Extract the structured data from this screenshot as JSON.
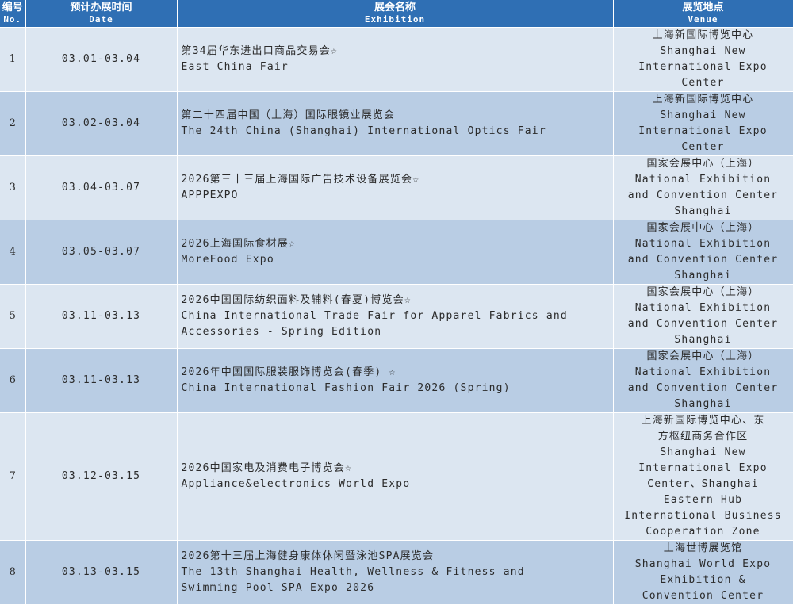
{
  "header": {
    "no_zh": "编号",
    "no_en": "No.",
    "date_zh": "预计办展时间",
    "date_en": "Date",
    "exhibition_zh": "展会名称",
    "exhibition_en": "Exhibition",
    "venue_zh": "展览地点",
    "venue_en": "Venue"
  },
  "rows": [
    {
      "no": "1",
      "date": "03.01-03.04",
      "exhibition": [
        "第34届华东进出口商品交易会☆",
        "East China Fair"
      ],
      "venue": [
        "上海新国际博览中心",
        "Shanghai New",
        "International Expo",
        "Center"
      ]
    },
    {
      "no": "2",
      "date": "03.02-03.04",
      "exhibition": [
        "第二十四届中国（上海）国际眼镜业展览会",
        "The 24th China (Shanghai) International Optics Fair"
      ],
      "venue": [
        "上海新国际博览中心",
        "Shanghai New",
        "International Expo",
        "Center"
      ]
    },
    {
      "no": "3",
      "date": "03.04-03.07",
      "exhibition": [
        "2026第三十三届上海国际广告技术设备展览会☆",
        "APPPEXPO"
      ],
      "venue": [
        "国家会展中心（上海）",
        "National Exhibition",
        "and Convention Center",
        "Shanghai"
      ]
    },
    {
      "no": "4",
      "date": "03.05-03.07",
      "exhibition": [
        "2026上海国际食材展☆",
        "MoreFood Expo"
      ],
      "venue": [
        "国家会展中心（上海）",
        "National Exhibition",
        "and Convention Center",
        "Shanghai"
      ]
    },
    {
      "no": "5",
      "date": "03.11-03.13",
      "exhibition": [
        "2026中国国际纺织面料及辅料(春夏)博览会☆",
        "China International Trade Fair for Apparel Fabrics and",
        "Accessories - Spring Edition"
      ],
      "venue": [
        "国家会展中心（上海）",
        "National Exhibition",
        "and Convention Center",
        "Shanghai"
      ]
    },
    {
      "no": "6",
      "date": "03.11-03.13",
      "exhibition": [
        "2026年中国国际服装服饰博览会(春季) ☆",
        "China International Fashion Fair 2026 (Spring)"
      ],
      "venue": [
        "国家会展中心（上海）",
        "National Exhibition",
        "and Convention Center",
        "Shanghai"
      ]
    },
    {
      "no": "7",
      "date": "03.12-03.15",
      "exhibition": [
        "2026中国家电及消费电子博览会☆",
        "Appliance&electronics World Expo"
      ],
      "venue": [
        "上海新国际博览中心、东",
        "方枢纽商务合作区",
        "Shanghai New",
        "International Expo",
        "Center、Shanghai",
        "Eastern Hub",
        "International Business",
        "Cooperation Zone"
      ]
    },
    {
      "no": "8",
      "date": "03.13-03.15",
      "exhibition": [
        "2026第十三届上海健身康体休闲暨泳池SPA展览会",
        "The 13th Shanghai Health, Wellness & Fitness and",
        "Swimming Pool SPA Expo 2026"
      ],
      "venue": [
        "上海世博展览馆",
        "Shanghai World Expo",
        "Exhibition &",
        "Convention Center"
      ]
    }
  ]
}
